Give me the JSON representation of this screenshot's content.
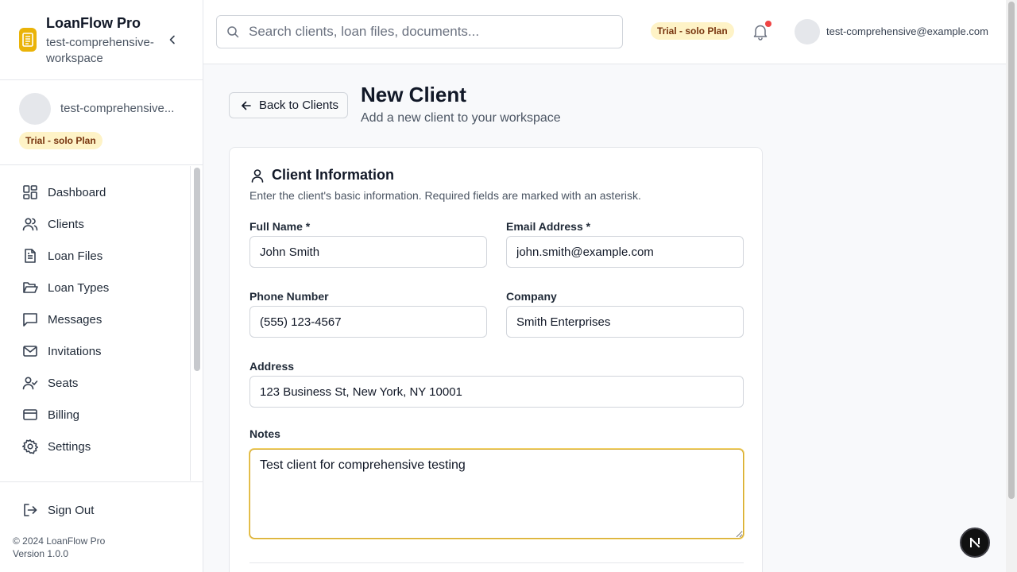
{
  "app": {
    "name": "LoanFlow Pro",
    "workspace": "test-comprehensive-workspace",
    "accent_color": "#eab308"
  },
  "sidebar": {
    "user_name": "test-comprehensive...",
    "plan_badge": "Trial - solo Plan",
    "items": [
      {
        "label": "Dashboard",
        "icon": "dashboard-icon"
      },
      {
        "label": "Clients",
        "icon": "users-icon"
      },
      {
        "label": "Loan Files",
        "icon": "file-text-icon"
      },
      {
        "label": "Loan Types",
        "icon": "folder-open-icon"
      },
      {
        "label": "Messages",
        "icon": "message-square-icon"
      },
      {
        "label": "Invitations",
        "icon": "mail-icon"
      },
      {
        "label": "Seats",
        "icon": "user-check-icon"
      },
      {
        "label": "Billing",
        "icon": "credit-card-icon"
      },
      {
        "label": "Settings",
        "icon": "gear-icon"
      }
    ],
    "sign_out": "Sign Out",
    "copyright": "© 2024 LoanFlow Pro",
    "version": "Version 1.0.0"
  },
  "header": {
    "search_placeholder": "Search clients, loan files, documents...",
    "plan_badge": "Trial - solo Plan",
    "user_email": "test-comprehensive@example.com",
    "has_notification": true
  },
  "page": {
    "back_button": "Back to Clients",
    "title": "New Client",
    "subtitle": "Add a new client to your workspace"
  },
  "form": {
    "title": "Client Information",
    "description": "Enter the client's basic information. Required fields are marked with an asterisk.",
    "full_name": {
      "label": "Full Name *",
      "value": "John Smith"
    },
    "email": {
      "label": "Email Address *",
      "value": "john.smith@example.com"
    },
    "phone": {
      "label": "Phone Number",
      "value": "(555) 123-4567"
    },
    "company": {
      "label": "Company",
      "value": "Smith Enterprises"
    },
    "address": {
      "label": "Address",
      "value": "123 Business St, New York, NY 10001"
    },
    "notes": {
      "label": "Notes",
      "value": "Test client for comprehensive testing"
    }
  },
  "dev_indicator": "N"
}
